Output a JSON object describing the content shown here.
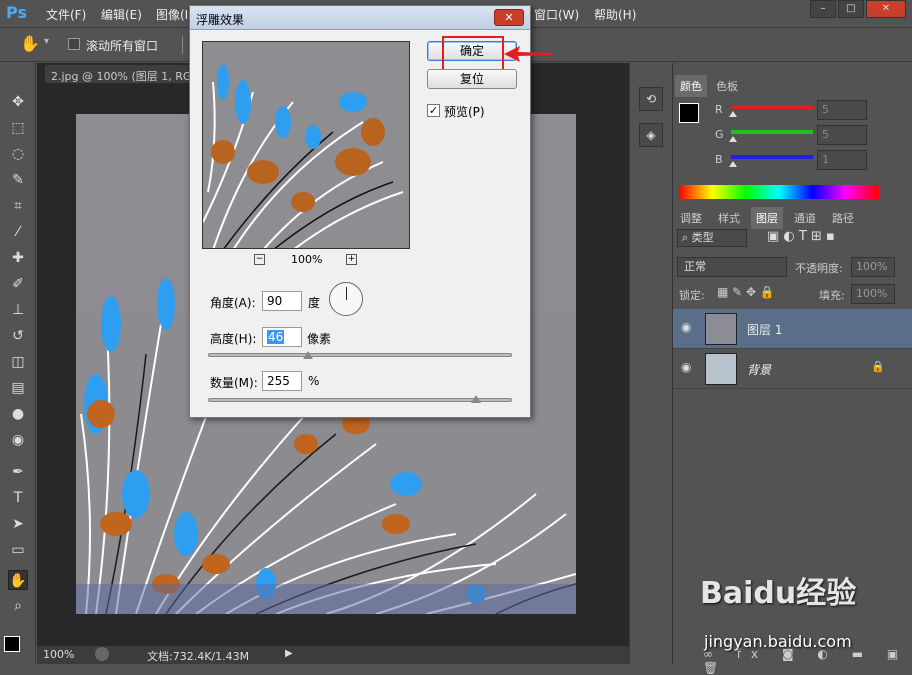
{
  "app": {
    "logo": "Ps"
  },
  "menu": [
    "文件(F)",
    "编辑(E)",
    "图像(I)",
    "窗口(W)",
    "帮助(H)"
  ],
  "window_controls": [
    "–",
    "□",
    "✕"
  ],
  "options": {
    "hand_icon": "hand-icon",
    "scroll_all": "滚动所有窗口"
  },
  "doc_tab": "2.jpg @ 100% (图层 1, RG",
  "status": {
    "zoom": "100%",
    "doc": "文档:732.4K/1.43M"
  },
  "dialog": {
    "title": "浮雕效果",
    "ok": "确定",
    "reset": "复位",
    "preview_label": "预览(P)",
    "preview_checked": true,
    "zoom": "100%",
    "angle_label": "角度(A):",
    "angle_value": "90",
    "angle_unit": "度",
    "height_label": "高度(H):",
    "height_value": "46",
    "height_unit": "像素",
    "amount_label": "数量(M):",
    "amount_value": "255",
    "amount_unit": "%",
    "height_slider": 0.33,
    "amount_slider": 0.88
  },
  "color_panel": {
    "tabs": [
      "颜色",
      "色板"
    ],
    "channels": [
      {
        "label": "R",
        "value": "5",
        "color": "#e02020"
      },
      {
        "label": "G",
        "value": "5",
        "color": "#20c020"
      },
      {
        "label": "B",
        "value": "1",
        "color": "#2020e0"
      }
    ]
  },
  "layers_panel": {
    "tabs": [
      "调整",
      "样式",
      "图层",
      "通道",
      "路径"
    ],
    "filter_label": "类型",
    "blend_mode": "正常",
    "opacity_label": "不透明度:",
    "opacity_value": "100%",
    "lock_label": "锁定:",
    "fill_label": "填充:",
    "fill_value": "100%",
    "layers": [
      {
        "name": "图层 1",
        "selected": true,
        "locked": false
      },
      {
        "name": "背景",
        "selected": false,
        "locked": true
      }
    ]
  },
  "watermark": {
    "brand": "Baidu经验",
    "url": "jingyan.baidu.com"
  }
}
